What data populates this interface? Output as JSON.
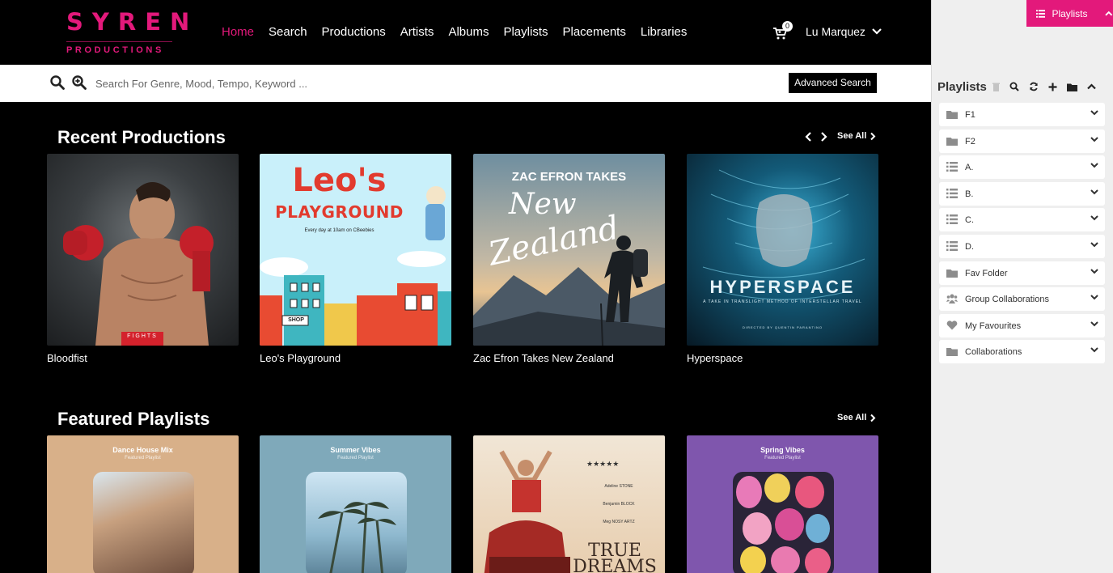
{
  "brand": {
    "name": "SYREN",
    "sub": "PRODUCTIONS",
    "accent": "#e3197b"
  },
  "nav": {
    "items": [
      {
        "label": "Home",
        "active": true
      },
      {
        "label": "Search"
      },
      {
        "label": "Productions"
      },
      {
        "label": "Artists"
      },
      {
        "label": "Albums"
      },
      {
        "label": "Playlists"
      },
      {
        "label": "Placements"
      },
      {
        "label": "Libraries"
      }
    ],
    "cart_count": "0",
    "user_name": "Lu Marquez"
  },
  "search": {
    "placeholder": "Search For Genre, Mood, Tempo, Keyword ...",
    "value": "",
    "advanced_label": "Advanced Search"
  },
  "recent": {
    "title": "Recent Productions",
    "see_all": "See All",
    "items": [
      {
        "label": "Bloodfist",
        "art_text": "FIGHTS"
      },
      {
        "label": "Leo's Playground",
        "art_title1": "Leo's",
        "art_title2": "PLAYGROUND",
        "art_sub": "Every day at 10am on CBeebies",
        "art_shop": "SHOP"
      },
      {
        "label": "Zac Efron Takes New Zealand",
        "art_title1": "ZAC EFRON TAKES",
        "art_title2": "New",
        "art_title3": "Zealand"
      },
      {
        "label": "Hyperspace",
        "art_title": "HYPERSPACE",
        "art_sub": "A TAKE IN TRANSLIGHT METHOD OF INTERSTELLAR TRAVEL",
        "art_credit": "DIRECTED BY QUENTIN PARANTINO"
      }
    ]
  },
  "featured": {
    "title": "Featured Playlists",
    "see_all": "See All",
    "items": [
      {
        "title": "Dance House Mix",
        "sub": "Featured Playlist",
        "bg": "#d8b089"
      },
      {
        "title": "Summer Vibes",
        "sub": "Featured Playlist",
        "bg": "#7fa9ba"
      },
      {
        "stars": "★★★★★",
        "title_big1": "TRUE",
        "title_big2": "DREAMS",
        "credits": [
          "Adeline STONE",
          "Benjamin BLOCK",
          "Meg NOSY ARTZ"
        ],
        "bg": "#e9d4bd"
      },
      {
        "title": "Spring Vibes",
        "sub": "Featured Playlist",
        "bg": "#7f56ad"
      }
    ]
  },
  "sidebar": {
    "toggle_label": "Playlists",
    "title": "Playlists",
    "items": [
      {
        "label": "F1",
        "icon": "folder-icon"
      },
      {
        "label": "F2",
        "icon": "folder-icon"
      },
      {
        "label": "A.",
        "icon": "list-icon"
      },
      {
        "label": "B.",
        "icon": "list-icon"
      },
      {
        "label": "C.",
        "icon": "list-icon"
      },
      {
        "label": "D.",
        "icon": "list-icon"
      },
      {
        "label": "Fav Folder",
        "icon": "folder-icon"
      },
      {
        "label": "Group Collaborations",
        "icon": "users-icon"
      },
      {
        "label": "My Favourites",
        "icon": "heart-icon"
      },
      {
        "label": "Collaborations",
        "icon": "folder-icon"
      }
    ]
  }
}
